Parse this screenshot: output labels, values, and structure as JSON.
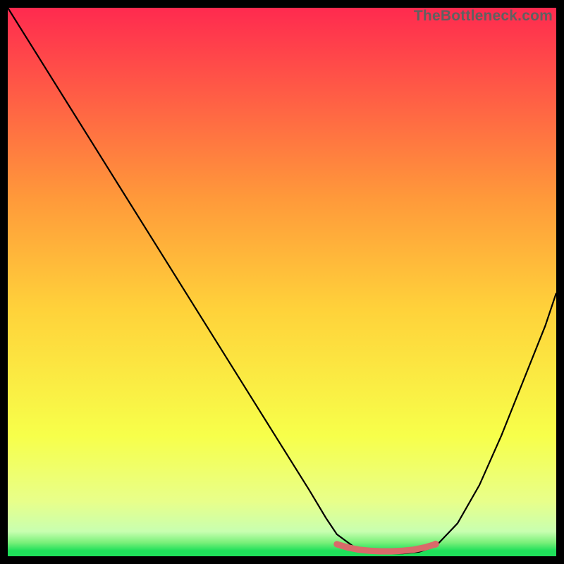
{
  "watermark": "TheBottleneck.com",
  "colors": {
    "gradient_top": "#ff2a4f",
    "gradient_mid_upper": "#ff7a3c",
    "gradient_mid": "#ffd23a",
    "gradient_lower": "#f7ff4a",
    "gradient_green": "#1fe05a",
    "curve": "#000000",
    "marker": "#d96a6a",
    "bg": "#000000"
  },
  "chart_data": {
    "type": "line",
    "title": "",
    "xlabel": "",
    "ylabel": "",
    "xlim": [
      0,
      100
    ],
    "ylim": [
      0,
      100
    ],
    "series": [
      {
        "name": "bottleneck-curve",
        "x": [
          0,
          5,
          10,
          15,
          20,
          25,
          30,
          35,
          40,
          45,
          50,
          55,
          58,
          60,
          63,
          66,
          69,
          72,
          75,
          78,
          82,
          86,
          90,
          94,
          98,
          100
        ],
        "y": [
          100,
          92,
          84,
          76,
          68,
          60,
          52,
          44,
          36,
          28,
          20,
          12,
          7,
          4,
          1.8,
          0.8,
          0.5,
          0.5,
          0.8,
          1.8,
          6,
          13,
          22,
          32,
          42,
          48
        ]
      },
      {
        "name": "optimal-range-marker",
        "x": [
          60,
          62,
          64,
          66,
          68,
          70,
          72,
          74,
          76,
          78
        ],
        "y": [
          2.2,
          1.6,
          1.2,
          1.0,
          0.9,
          0.9,
          1.0,
          1.2,
          1.6,
          2.2
        ]
      }
    ],
    "gradient_stops": [
      {
        "offset": 0.0,
        "color": "#ff2a4f"
      },
      {
        "offset": 0.35,
        "color": "#ff9a3a"
      },
      {
        "offset": 0.55,
        "color": "#ffd23a"
      },
      {
        "offset": 0.78,
        "color": "#f7ff4a"
      },
      {
        "offset": 0.9,
        "color": "#e8ff8a"
      },
      {
        "offset": 0.955,
        "color": "#c8ffb0"
      },
      {
        "offset": 0.975,
        "color": "#7af07a"
      },
      {
        "offset": 0.99,
        "color": "#1fe05a"
      },
      {
        "offset": 1.0,
        "color": "#1fe05a"
      }
    ]
  }
}
